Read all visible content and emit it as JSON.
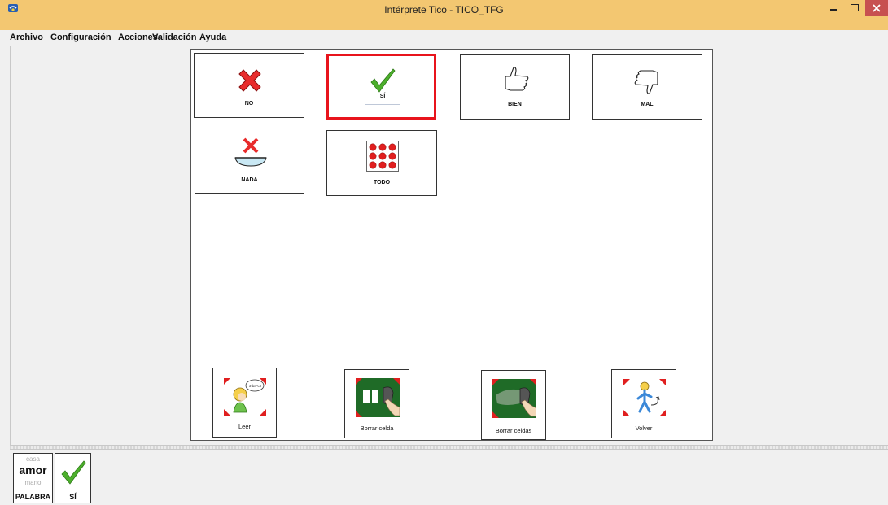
{
  "window": {
    "title": "Intérprete Tico - TICO_TFG",
    "titlebar_color": "#f3c771",
    "close_button_color": "#c75050",
    "controls": [
      "minimize-icon",
      "maximize-icon",
      "close-icon"
    ]
  },
  "menu": {
    "items": [
      {
        "label": "Archivo"
      },
      {
        "label": "Configuración"
      },
      {
        "label": "Acciones"
      },
      {
        "label": "Validación"
      },
      {
        "label": "Ayuda"
      }
    ]
  },
  "board": {
    "selection_color": "#e8141c",
    "cells": [
      {
        "label": "NO",
        "icon": "red-cross-icon",
        "selected": false
      },
      {
        "label": "SÍ",
        "icon": "green-check-icon",
        "selected": true
      },
      {
        "label": "BIEN",
        "icon": "thumbs-up-icon",
        "selected": false
      },
      {
        "label": "MAL",
        "icon": "thumbs-down-icon",
        "selected": false
      },
      {
        "label": "NADA",
        "icon": "empty-bowl-cross-icon",
        "selected": false
      },
      {
        "label": "TODO",
        "icon": "red-dots-grid-icon",
        "selected": false
      }
    ],
    "controls": [
      {
        "label": "Leer",
        "icon": "read-aloud-icon"
      },
      {
        "label": "Borrar celda",
        "icon": "erase-cell-icon"
      },
      {
        "label": "Borrar celdas",
        "icon": "erase-cells-icon"
      },
      {
        "label": "Volver",
        "icon": "go-back-icon"
      }
    ]
  },
  "sentence_bar": {
    "palabra_card": {
      "word_above": "casa",
      "word_current": "amor",
      "word_below": "mano",
      "label": "PALABRA"
    },
    "cards": [
      {
        "label": "SÍ",
        "icon": "green-check-icon"
      }
    ]
  }
}
